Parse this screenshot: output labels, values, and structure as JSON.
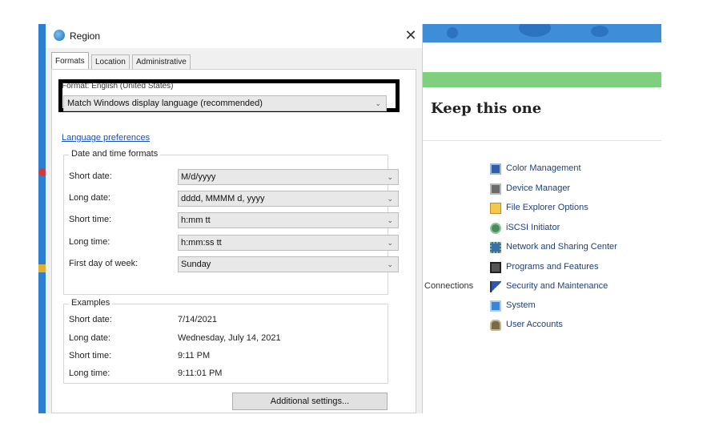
{
  "dialog": {
    "title": "Region",
    "close_glyph": "✕",
    "tabs": [
      {
        "label": "Formats",
        "active": true
      },
      {
        "label": "Location",
        "active": false
      },
      {
        "label": "Administrative",
        "active": false
      }
    ],
    "format_label": "Format: English (United States)",
    "format_value": "Match Windows display language (recommended)",
    "language_link": "Language preferences",
    "date_time_group": {
      "title": "Date and time formats",
      "rows": [
        {
          "label": "Short date:",
          "value": "M/d/yyyy"
        },
        {
          "label": "Long date:",
          "value": "dddd, MMMM d, yyyy"
        },
        {
          "label": "Short time:",
          "value": "h:mm tt"
        },
        {
          "label": "Long time:",
          "value": "h:mm:ss tt"
        },
        {
          "label": "First day of week:",
          "value": "Sunday"
        }
      ]
    },
    "examples_group": {
      "title": "Examples",
      "rows": [
        {
          "label": "Short date:",
          "value": "7/14/2021"
        },
        {
          "label": "Long date:",
          "value": "Wednesday, July 14, 2021"
        },
        {
          "label": "Short time:",
          "value": "9:11 PM"
        },
        {
          "label": "Long time:",
          "value": "9:11:01 PM"
        }
      ]
    },
    "additional_settings": "Additional settings..."
  },
  "control_panel": {
    "heading": "Keep this one",
    "connections_label": "Connections",
    "items": [
      {
        "label": "Color Management",
        "icon": "monitor-icon"
      },
      {
        "label": "Device Manager",
        "icon": "device-manager-icon"
      },
      {
        "label": "File Explorer Options",
        "icon": "folder-options-icon"
      },
      {
        "label": "iSCSI Initiator",
        "icon": "globe-icon"
      },
      {
        "label": "Network and Sharing Center",
        "icon": "network-icon"
      },
      {
        "label": "Programs and Features",
        "icon": "programs-icon"
      },
      {
        "label": "Security and Maintenance",
        "icon": "flag-icon"
      },
      {
        "label": "System",
        "icon": "system-icon"
      },
      {
        "label": "User Accounts",
        "icon": "users-icon"
      }
    ]
  },
  "colors": {
    "highlight_frame": "#000000",
    "link": "#1a4fb5",
    "banner": "#3d8dd8",
    "green_bar": "#7ed07e"
  }
}
